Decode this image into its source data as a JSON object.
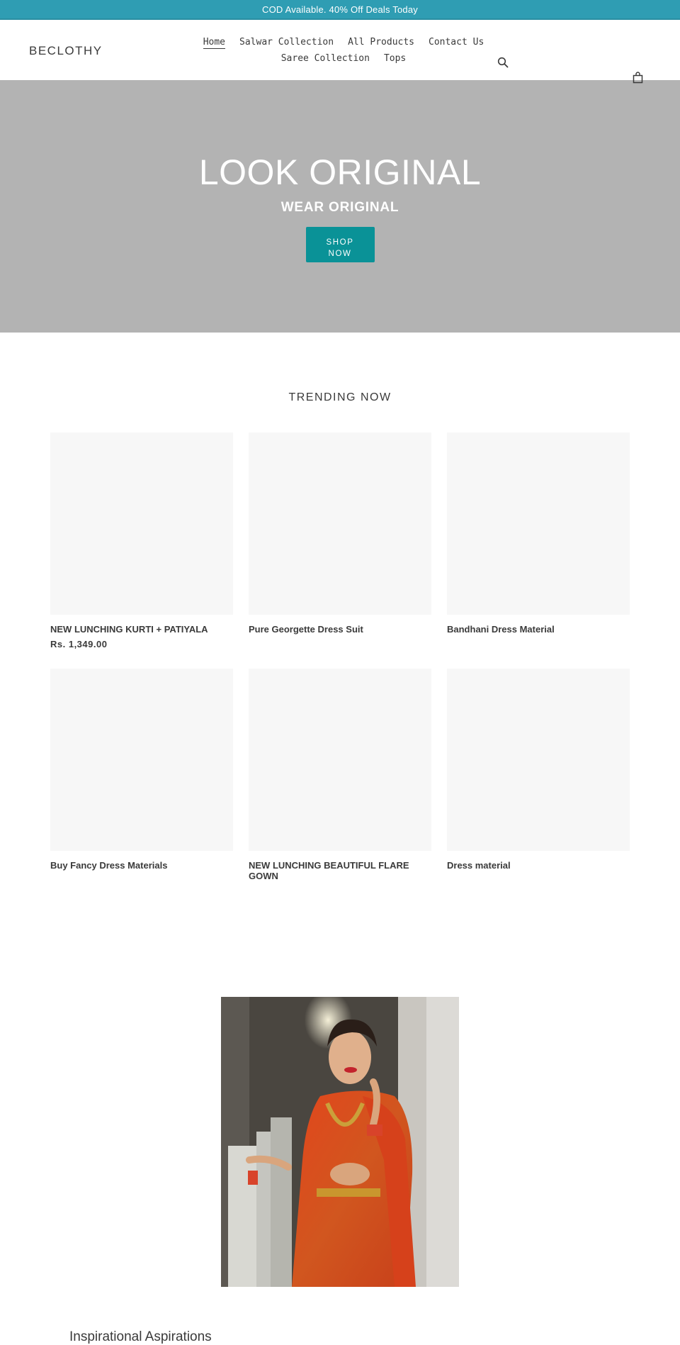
{
  "announcement": {
    "text": "COD Available. 40% Off Deals Today"
  },
  "header": {
    "logo": "BECLOTHY",
    "nav": [
      {
        "label": "Home",
        "active": true
      },
      {
        "label": "Salwar Collection",
        "active": false
      },
      {
        "label": "All Products",
        "active": false
      },
      {
        "label": "Contact Us",
        "active": false
      },
      {
        "label": "Saree Collection",
        "active": false
      },
      {
        "label": "Tops",
        "active": false
      }
    ],
    "icons": {
      "search": "search-icon",
      "cart": "shopping-bag-icon"
    }
  },
  "hero": {
    "title": "LOOK ORIGINAL",
    "subtitle": "WEAR ORIGINAL",
    "button_label": "SHOP NOW",
    "background_color": "#b3b3b3",
    "button_color": "#0a9297"
  },
  "trending": {
    "title": "TRENDING NOW",
    "products": [
      {
        "title": "NEW LUNCHING KURTI + PATIYALA",
        "price": "Rs. 1,349.00"
      },
      {
        "title": "Pure Georgette Dress Suit",
        "price": ""
      },
      {
        "title": "Bandhani Dress Material",
        "price": ""
      },
      {
        "title": "Buy Fancy Dress Materials",
        "price": ""
      },
      {
        "title": "NEW LUNCHING BEAUTIFUL FLARE GOWN",
        "price": ""
      },
      {
        "title": "Dress material",
        "price": ""
      }
    ]
  },
  "feature": {
    "image_alt": "Woman in orange silk saree with gold jewellery",
    "heading": "Inspirational Aspirations"
  },
  "colors": {
    "announcement_bg": "#2f9db3",
    "text": "#3a3a3a",
    "placeholder": "#f7f7f7"
  }
}
